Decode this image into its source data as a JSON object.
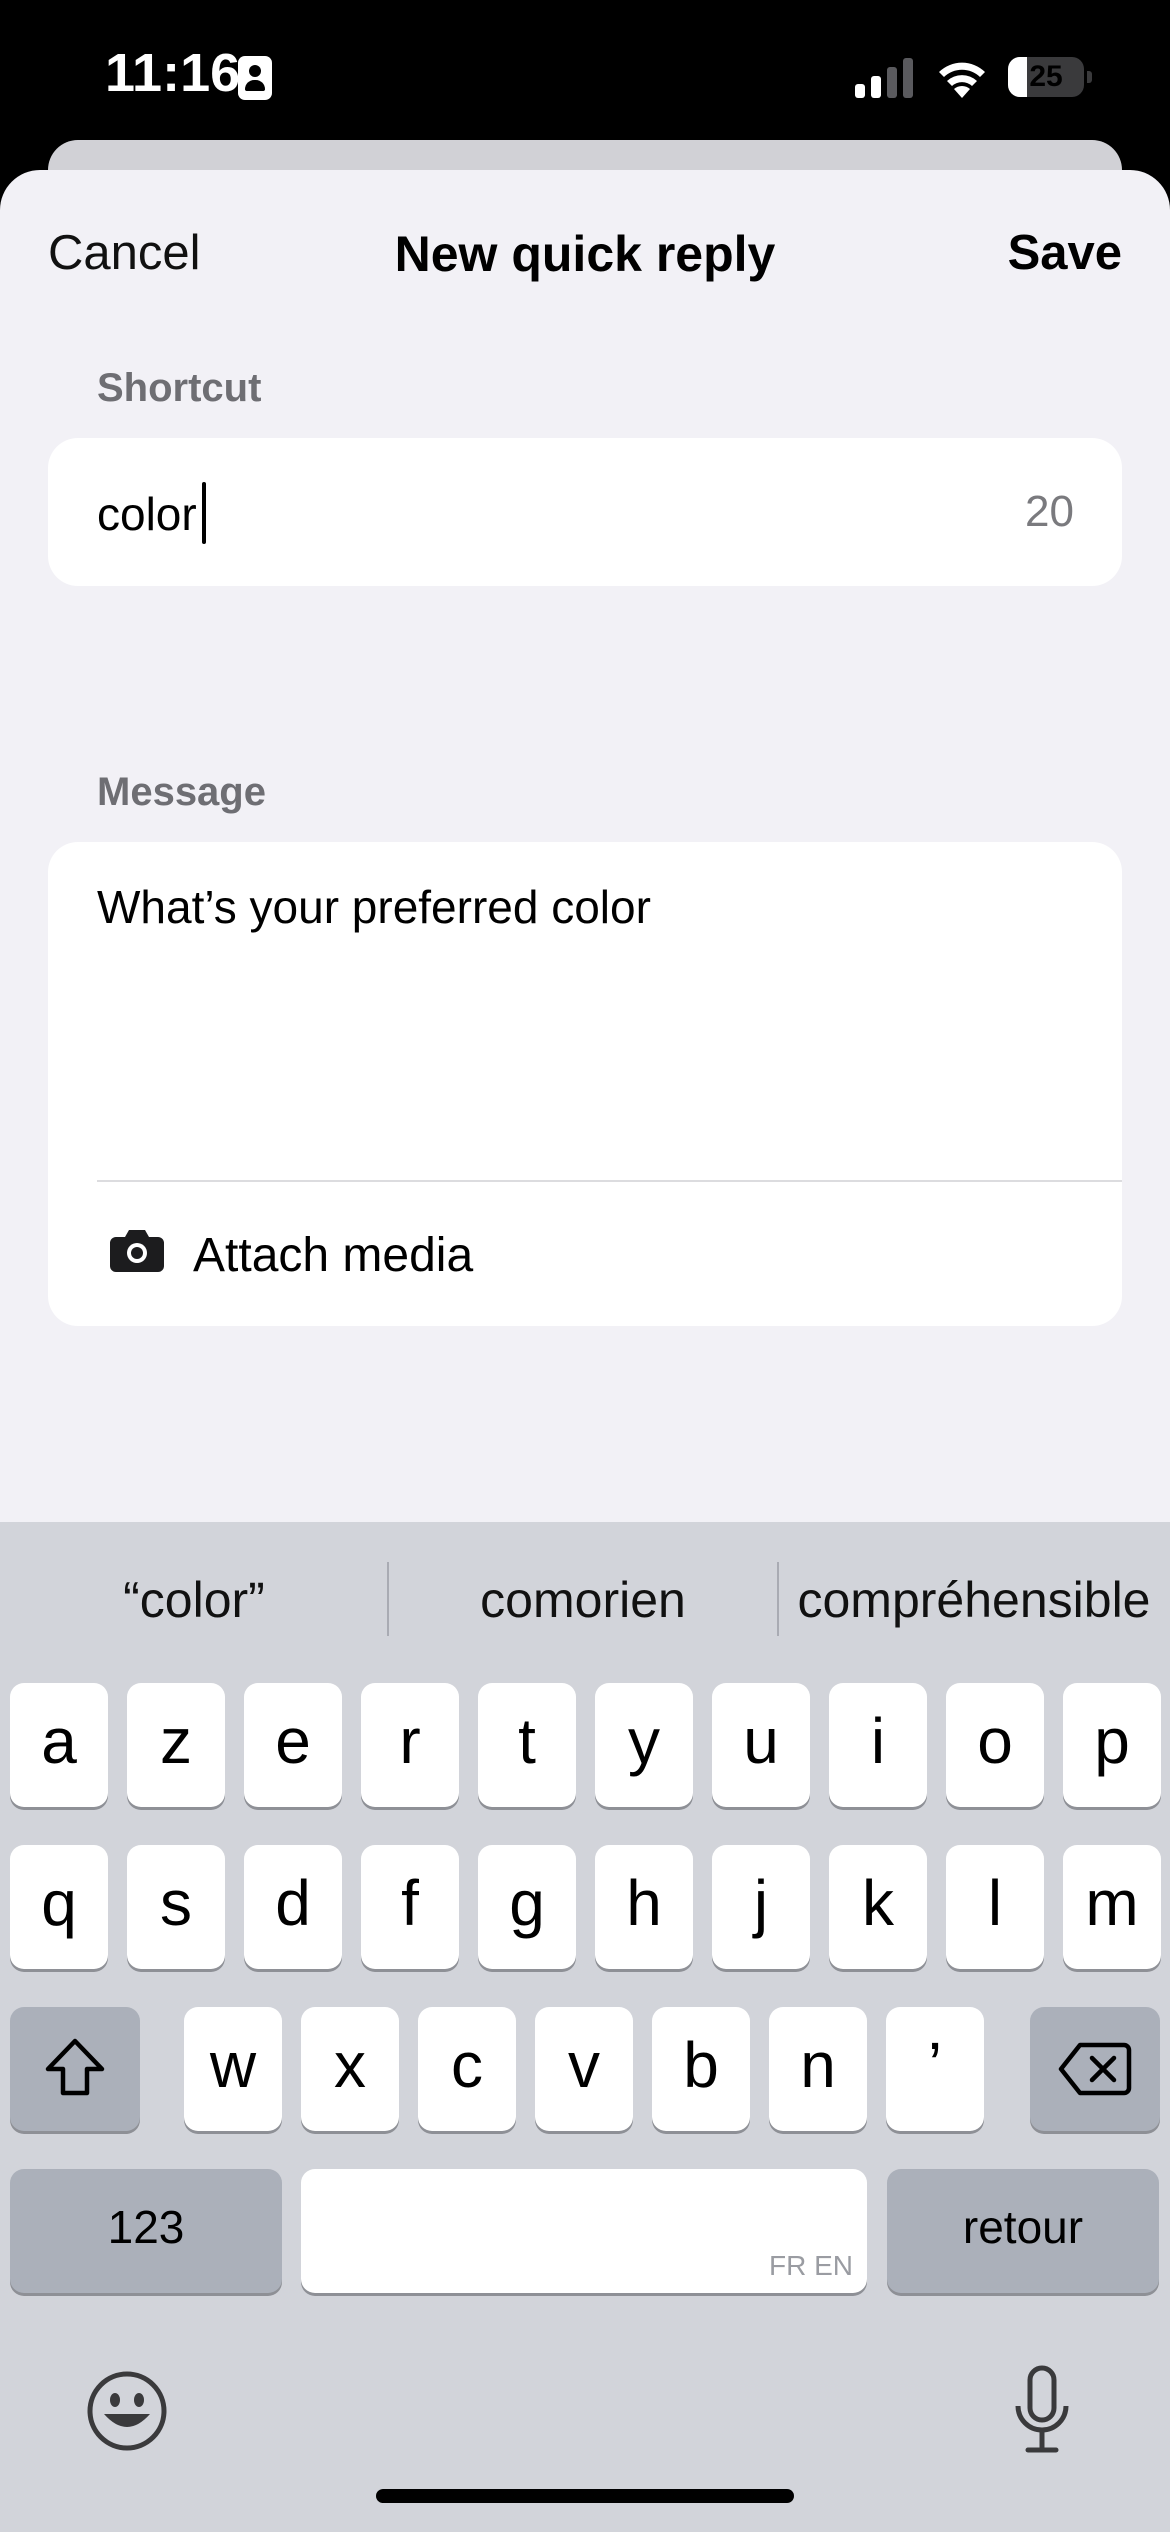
{
  "status_bar": {
    "time": "11:16",
    "battery_level": "25",
    "battery_fraction": 0.25,
    "icons": [
      "contact-card-icon",
      "cellular-signal-icon",
      "wifi-icon",
      "battery-icon"
    ]
  },
  "sheet": {
    "cancel_label": "Cancel",
    "title": "New quick reply",
    "save_label": "Save"
  },
  "shortcut": {
    "label": "Shortcut",
    "value": "color",
    "counter": "20"
  },
  "message": {
    "label": "Message",
    "value": "What’s your preferred color",
    "attach_label": "Attach media",
    "attach_icon": "camera-icon"
  },
  "keyboard": {
    "suggestions": [
      "“color”",
      "comorien",
      "compréhensible"
    ],
    "row1": [
      "a",
      "z",
      "e",
      "r",
      "t",
      "y",
      "u",
      "i",
      "o",
      "p"
    ],
    "row2": [
      "q",
      "s",
      "d",
      "f",
      "g",
      "h",
      "j",
      "k",
      "l",
      "m"
    ],
    "row3": [
      "w",
      "x",
      "c",
      "v",
      "b",
      "n",
      "’"
    ],
    "numbers_label": "123",
    "return_label": "retour",
    "space_language_label": "FR EN",
    "icons": [
      "shift-icon",
      "backspace-icon",
      "emoji-icon",
      "microphone-icon"
    ]
  },
  "colors": {
    "sheet_background": "#f2f1f6",
    "card_background": "#ffffff",
    "keyboard_background": "#d2d4da",
    "label_gray": "#6e6e73"
  }
}
